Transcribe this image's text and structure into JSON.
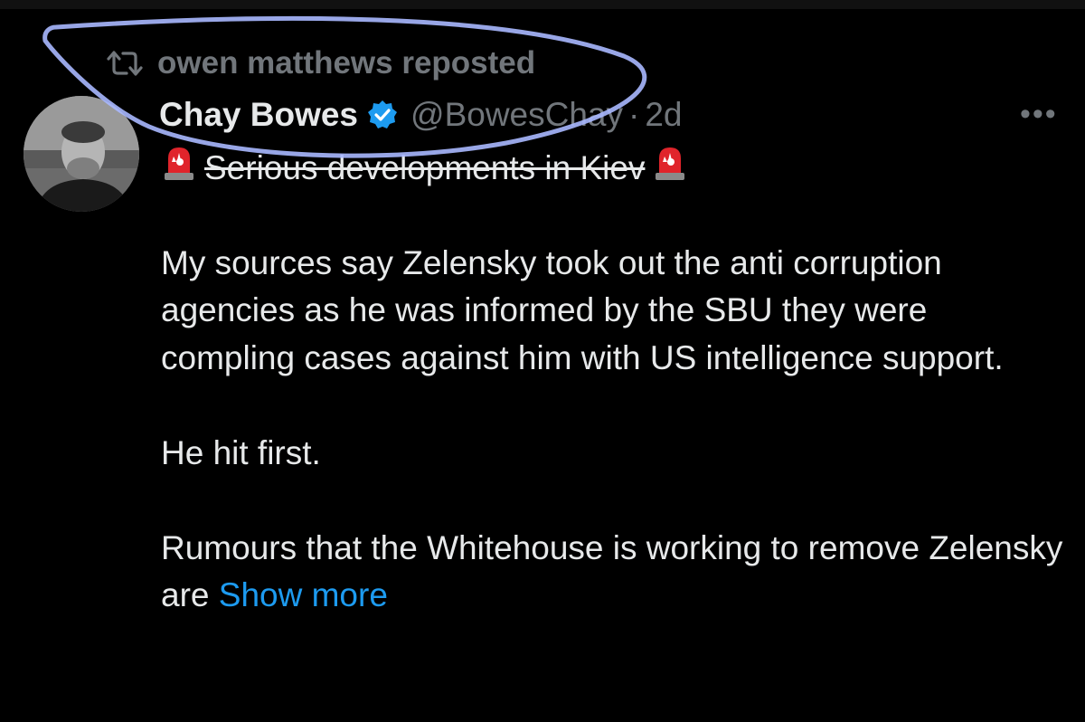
{
  "repost": {
    "label": "owen matthews reposted",
    "icon": "repost-icon"
  },
  "author": {
    "name": "Chay Bowes",
    "verified_icon": "verified-badge-icon",
    "handle": "@BowesChay",
    "separator": "·",
    "time": "2d"
  },
  "more_label": "•••",
  "tweet": {
    "headline": "Serious developments in Kiev",
    "headline_icon": "police-siren-emoji",
    "paragraphs": [
      "My sources say Zelensky took out the anti corruption agencies as he was informed by the SBU they were compling cases against him with US intelligence support.",
      "He hit first.",
      "Rumours that the Whitehouse is working to remove Zelensky are"
    ],
    "show_more": "Show more"
  },
  "colors": {
    "background": "#000000",
    "text": "#e7e9ea",
    "muted": "#71767b",
    "link": "#1d9bf0",
    "verified": "#1d9bf0",
    "annotation": "#a9b8ff"
  }
}
